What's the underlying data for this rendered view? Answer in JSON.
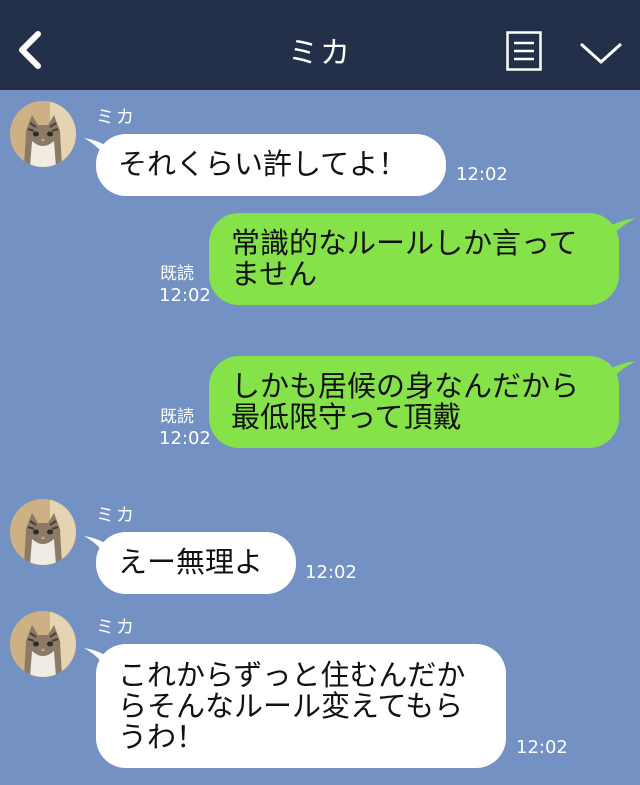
{
  "header": {
    "title": "ミカ",
    "back_icon": "chevron-left-icon",
    "menu_icon": "menu-icon",
    "collapse_icon": "chevron-down-icon"
  },
  "colors": {
    "header_bg": "#243049",
    "chat_bg": "#7391c3",
    "incoming_bubble": "#ffffff",
    "outgoing_bubble": "#85e249"
  },
  "messages": [
    {
      "direction": "in",
      "sender": "ミカ",
      "text": "それくらい許してよ！",
      "time": "12:02"
    },
    {
      "direction": "out",
      "read": "既読",
      "text": "常識的なルールしか言って\nません",
      "time": "12:02"
    },
    {
      "direction": "out",
      "read": "既読",
      "text": "しかも居候の身なんだから\n最低限守って頂戴",
      "time": "12:02"
    },
    {
      "direction": "in",
      "sender": "ミカ",
      "text": "えー無理よ",
      "time": "12:02"
    },
    {
      "direction": "in",
      "sender": "ミカ",
      "text": "これからずっと住むんだか\nらそんなルール変えてもら\nうわ！",
      "time": "12:02"
    }
  ]
}
